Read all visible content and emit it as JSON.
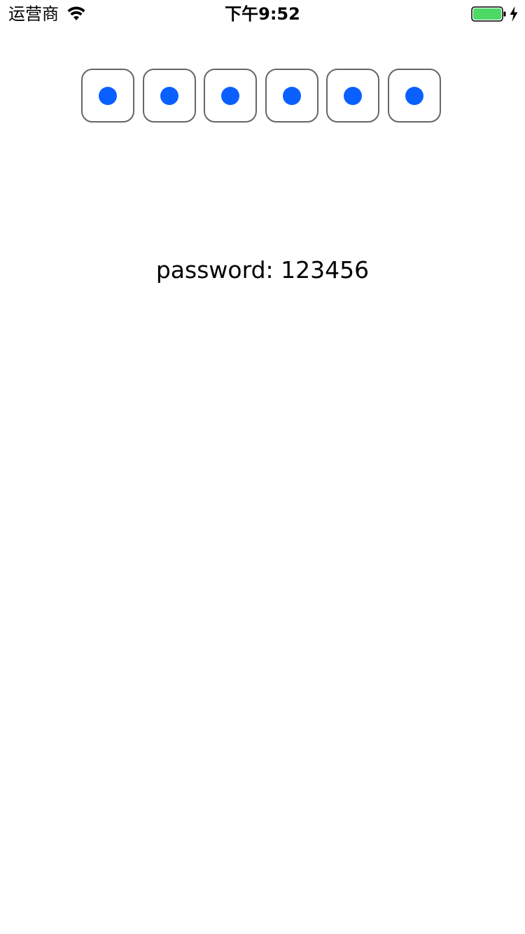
{
  "status_bar": {
    "carrier": "运营商",
    "time": "下午9:52",
    "battery_color": "#4cd964",
    "wifi_icon": "wifi-icon",
    "battery_icon": "battery-icon",
    "charging_icon": "charging-bolt-icon",
    "battery_level": 1.0
  },
  "pin": {
    "length": 6,
    "filled_count": 6,
    "dot_color": "#0a60ff",
    "border_color": "#666666"
  },
  "password_label": "password: 123456"
}
